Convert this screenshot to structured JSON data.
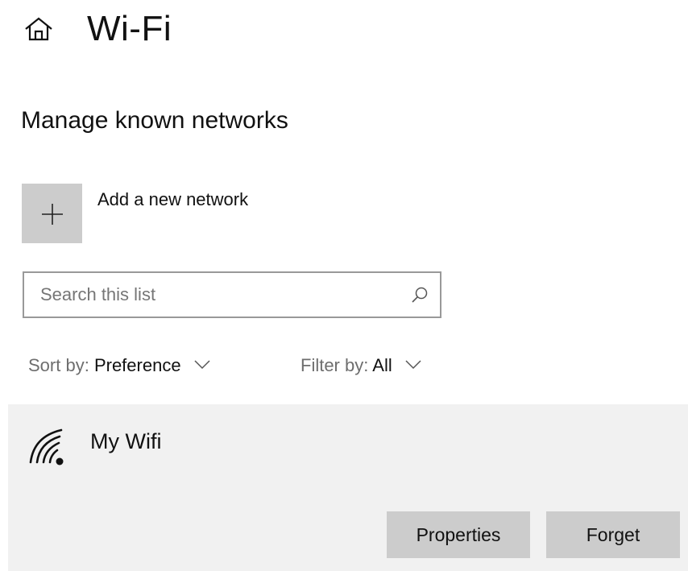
{
  "header": {
    "title": "Wi-Fi",
    "home_icon": "home-icon"
  },
  "section": {
    "title": "Manage known networks"
  },
  "add_network": {
    "label": "Add a new network",
    "icon": "plus-icon"
  },
  "search": {
    "placeholder": "Search this list",
    "value": "",
    "icon": "search-icon"
  },
  "sort": {
    "label": "Sort by:",
    "value": "Preference"
  },
  "filter": {
    "label": "Filter by:",
    "value": "All"
  },
  "networks": [
    {
      "name": "My Wifi",
      "icon": "wifi-signal-icon",
      "actions": {
        "properties": "Properties",
        "forget": "Forget"
      }
    }
  ],
  "colors": {
    "tile_bg": "#cccccc",
    "item_bg": "#f1f1f1",
    "border": "#999999",
    "muted_text": "#6e6e6e"
  }
}
